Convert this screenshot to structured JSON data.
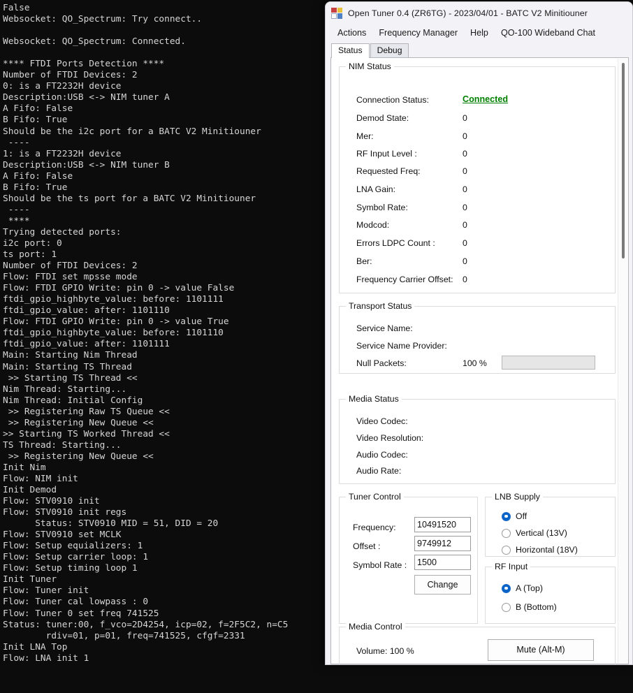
{
  "terminal": {
    "lines": [
      "False",
      "Websocket: QO_Spectrum: Try connect..",
      "",
      "Websocket: QO_Spectrum: Connected.",
      "",
      "**** FTDI Ports Detection ****",
      "Number of FTDI Devices: 2",
      "0: is a FT2232H device",
      "Description:USB <-> NIM tuner A",
      "A Fifo: False",
      "B Fifo: True",
      "Should be the i2c port for a BATC V2 Minitiouner",
      " ----",
      "1: is a FT2232H device",
      "Description:USB <-> NIM tuner B",
      "A Fifo: False",
      "B Fifo: True",
      "Should be the ts port for a BATC V2 Minitiouner",
      " ----",
      " ****",
      "Trying detected ports:",
      "i2c port: 0",
      "ts port: 1",
      "Number of FTDI Devices: 2",
      "Flow: FTDI set mpsse mode",
      "Flow: FTDI GPIO Write: pin 0 -> value False",
      "ftdi_gpio_highbyte_value: before: 1101111",
      "ftdi_gpio_value: after: 1101110",
      "Flow: FTDI GPIO Write: pin 0 -> value True",
      "ftdi_gpio_highbyte_value: before: 1101110",
      "ftdi_gpio_value: after: 1101111",
      "Main: Starting Nim Thread",
      "Main: Starting TS Thread",
      " >> Starting TS Thread <<",
      "Nim Thread: Starting...",
      "Nim Thread: Initial Config",
      " >> Registering Raw TS Queue <<",
      " >> Registering New Queue <<",
      ">> Starting TS Worked Thread <<",
      "TS Thread: Starting...",
      " >> Registering New Queue <<",
      "Init Nim",
      "Flow: NIM init",
      "Init Demod",
      "Flow: STV0910 init",
      "Flow: STV0910 init regs",
      "      Status: STV0910 MID = 51, DID = 20",
      "Flow: STV0910 set MCLK",
      "Flow: Setup equializers: 1",
      "Flow: Setup carrier loop: 1",
      "Flow: Setup timing loop 1",
      "Init Tuner",
      "Flow: Tuner init",
      "Flow: Tuner cal lowpass : 0",
      "Flow: Tuner 0 set freq 741525",
      "Status: tuner:00, f_vco=2D4254, icp=02, f=2F5C2, n=C5",
      "        rdiv=01, p=01, freq=741525, cfgf=2331",
      "Init LNA Top",
      "Flow: LNA init 1"
    ]
  },
  "window": {
    "title": "Open Tuner 0.4 (ZR6TG) - 2023/04/01 - BATC V2 Minitiouner",
    "icon": "app-grid-icon"
  },
  "menubar": {
    "items": [
      {
        "label": "Actions"
      },
      {
        "label": "Frequency Manager"
      },
      {
        "label": "Help"
      },
      {
        "label": "QO-100 Wideband Chat"
      }
    ]
  },
  "tabs": [
    {
      "label": "Status",
      "active": true
    },
    {
      "label": "Debug",
      "active": false
    }
  ],
  "nim_status": {
    "legend": "NIM Status",
    "rows": [
      {
        "label": "Connection Status:",
        "value": "Connected",
        "highlight": true
      },
      {
        "label": "Demod State:",
        "value": "0"
      },
      {
        "label": "Mer:",
        "value": "0"
      },
      {
        "label": "RF Input Level :",
        "value": "0"
      },
      {
        "label": "Requested Freq:",
        "value": "0"
      },
      {
        "label": "LNA Gain:",
        "value": "0"
      },
      {
        "label": "Symbol Rate:",
        "value": "0"
      },
      {
        "label": "Modcod:",
        "value": "0"
      },
      {
        "label": "Errors LDPC Count :",
        "value": "0"
      },
      {
        "label": "Ber:",
        "value": "0"
      },
      {
        "label": "Frequency Carrier Offset:",
        "value": "0"
      }
    ],
    "connected_color": "#008000"
  },
  "transport_status": {
    "legend": "Transport Status",
    "rows": [
      {
        "label": "Service Name:",
        "value": ""
      },
      {
        "label": "Service Name Provider:",
        "value": ""
      }
    ],
    "null_packets": {
      "label": "Null Packets:",
      "value": "100 %",
      "progress": 0
    }
  },
  "media_status": {
    "legend": "Media Status",
    "rows": [
      {
        "label": "Video Codec:",
        "value": ""
      },
      {
        "label": "Video Resolution:",
        "value": ""
      },
      {
        "label": "Audio Codec:",
        "value": ""
      },
      {
        "label": "Audio Rate:",
        "value": ""
      }
    ]
  },
  "tuner_control": {
    "legend": "Tuner Control",
    "frequency": {
      "label": "Frequency:",
      "value": "10491520"
    },
    "offset": {
      "label": "Offset :",
      "value": "9749912"
    },
    "symbol_rate": {
      "label": "Symbol Rate :",
      "value": "1500"
    },
    "change_button": "Change"
  },
  "lnb_supply": {
    "legend": "LNB Supply",
    "options": [
      {
        "label": "Off",
        "selected": true
      },
      {
        "label": "Vertical (13V)",
        "selected": false
      },
      {
        "label": "Horizontal (18V)",
        "selected": false
      }
    ]
  },
  "rf_input": {
    "legend": "RF Input",
    "options": [
      {
        "label": "A (Top)",
        "selected": true
      },
      {
        "label": "B (Bottom)",
        "selected": false
      }
    ]
  },
  "media_control": {
    "legend": "Media Control",
    "volume": "Volume: 100 %",
    "mute_button": "Mute (Alt-M)"
  },
  "accent_color": "#0a64c8"
}
